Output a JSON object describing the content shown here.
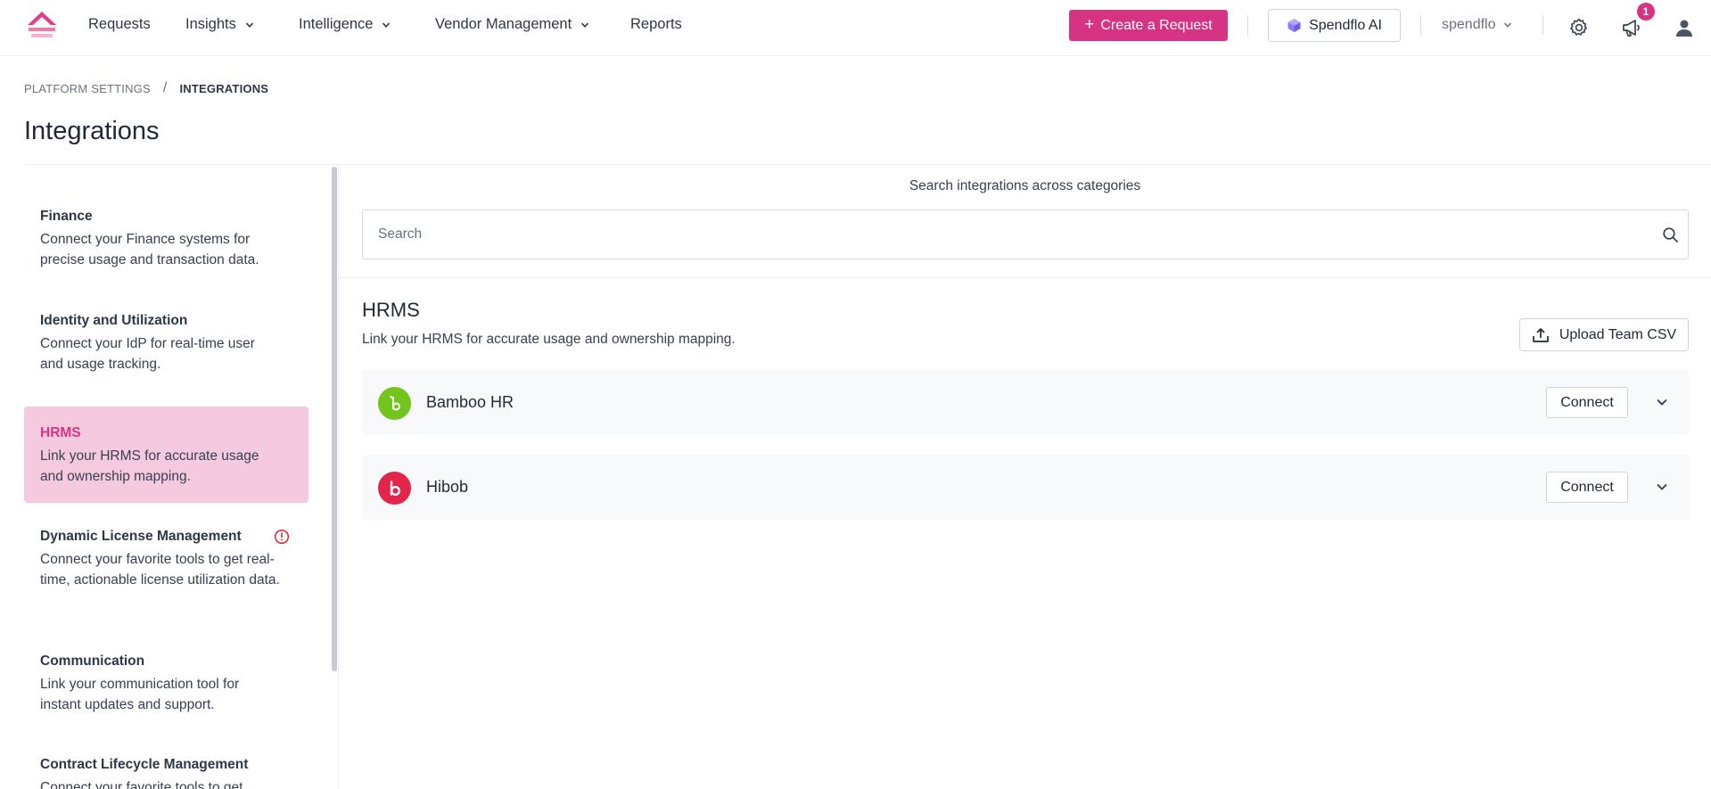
{
  "nav": {
    "items": [
      {
        "label": "Requests"
      },
      {
        "label": "Insights"
      },
      {
        "label": "Intelligence"
      },
      {
        "label": "Vendor Management"
      },
      {
        "label": "Reports"
      }
    ],
    "create_label": "Create a Request",
    "ai_label": "Spendflo AI",
    "org_label": "spendflo",
    "notification_count": "1",
    "icons": [
      "logo-icon",
      "chevron-down-icon",
      "plus-icon",
      "ai-cube-icon",
      "gear-icon",
      "megaphone-icon",
      "user-avatar-icon"
    ]
  },
  "breadcrumb": {
    "parent": "PLATFORM SETTINGS",
    "separator": "/",
    "current": "INTEGRATIONS"
  },
  "page": {
    "title": "Integrations"
  },
  "sidebar": {
    "categories": [
      {
        "title": "Finance",
        "description": "Connect your Finance systems for precise usage and transaction data.",
        "active": false
      },
      {
        "title": "Identity and Utilization",
        "description": "Connect your IdP for real-time user and usage tracking.",
        "active": false
      },
      {
        "title": "HRMS",
        "description": "Link your HRMS for accurate usage and ownership mapping.",
        "active": true
      },
      {
        "title": "Dynamic License Management",
        "description": "Connect your favorite tools to get real-time, actionable license utilization data.",
        "active": false,
        "warning": true
      },
      {
        "title": "Communication",
        "description": "Link your communication tool for instant updates and support.",
        "active": false
      },
      {
        "title": "Contract Lifecycle Management",
        "description": "Connect your favorite tools to get",
        "active": false
      }
    ]
  },
  "search": {
    "caption": "Search integrations across categories",
    "placeholder": "Search"
  },
  "section": {
    "title": "HRMS",
    "description": "Link your HRMS for accurate usage and ownership mapping.",
    "upload_label": "Upload Team CSV"
  },
  "integrations": [
    {
      "name": "Bamboo HR",
      "connect_label": "Connect",
      "logo_color": "#73c41d",
      "logo_glyph": "b"
    },
    {
      "name": "Hibob",
      "connect_label": "Connect",
      "logo_color": "#e3244b",
      "logo_glyph": "b"
    }
  ],
  "colors": {
    "brand": "#d63384",
    "active_bg": "#f5c9de",
    "warning": "#dc2626"
  }
}
